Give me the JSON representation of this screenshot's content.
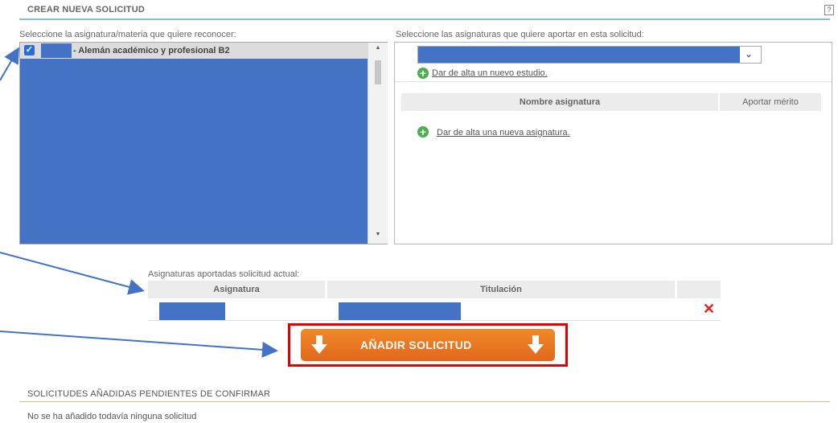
{
  "create": {
    "title": "CREAR NUEVA SOLICITUD",
    "help": "?"
  },
  "left_panel": {
    "label": "Seleccione la asignatura/materia que quiere reconocer:",
    "selected_item": "- Alemán académico y profesional B2",
    "checked": true
  },
  "right_panel": {
    "label": "Seleccione las asignaturas que quiere aportar en esta solicitud:",
    "dropdown_value": "",
    "new_study_link": "Dar de alta un nuevo estudio.",
    "table_headers": [
      "Nombre asignatura",
      "Aportar mérito"
    ],
    "new_subject_link": "Dar de alta una nueva asignatura."
  },
  "contributed": {
    "label": "Asignaturas aportadas solicitud actual:",
    "headers": [
      "Asignatura",
      "Titulación",
      ""
    ],
    "remove_icon": "✕"
  },
  "add_button": {
    "label": "AÑADIR SOLICITUD"
  },
  "pending": {
    "title": "SOLICITUDES AÑADIDAS PENDIENTES DE CONFIRMAR",
    "empty_text": "No se ha añadido todavía ninguna solicitud"
  },
  "colors": {
    "redacted": "#4472c4",
    "accent_orange": "#e8731f",
    "highlight_red": "#e00000",
    "remove_red": "#d9261c"
  }
}
